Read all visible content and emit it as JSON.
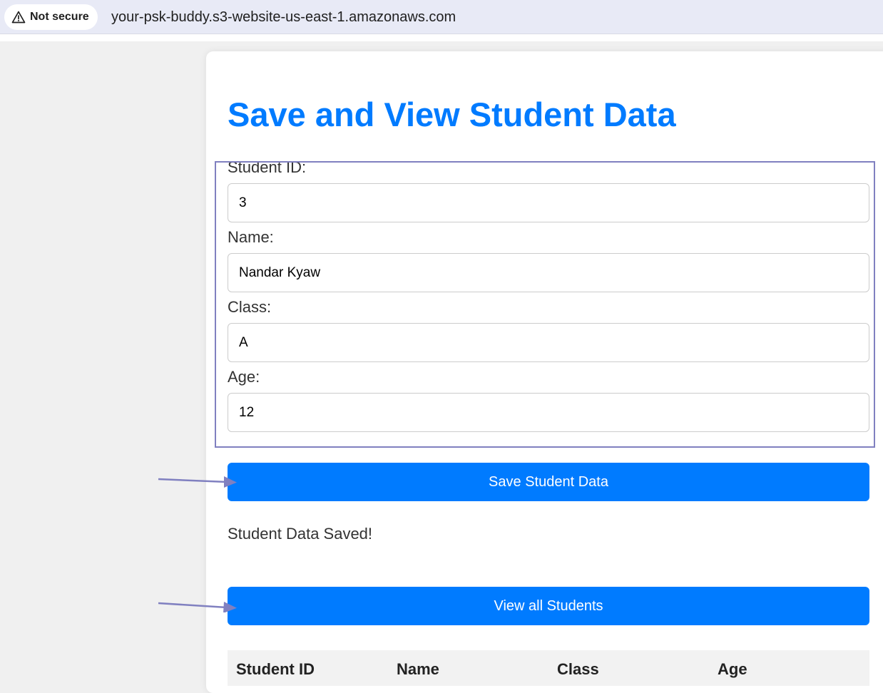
{
  "browser": {
    "security_label": "Not secure",
    "url": "your-psk-buddy.s3-website-us-east-1.amazonaws.com",
    "security_icon": "warning-triangle-icon"
  },
  "page": {
    "title": "Save and View Student Data",
    "accent_color": "#007bff"
  },
  "form": {
    "student_id": {
      "label": "Student ID:",
      "value": "3"
    },
    "name": {
      "label": "Name:",
      "value": "Nandar Kyaw"
    },
    "class": {
      "label": "Class:",
      "value": "A"
    },
    "age": {
      "label": "Age:",
      "value": "12"
    },
    "save_button": "Save Student Data"
  },
  "status": {
    "message": "Student Data Saved!"
  },
  "view_button": "View all Students",
  "table": {
    "headers": [
      "Student ID",
      "Name",
      "Class",
      "Age"
    ]
  },
  "annotations": {
    "color": "#8080c0"
  }
}
